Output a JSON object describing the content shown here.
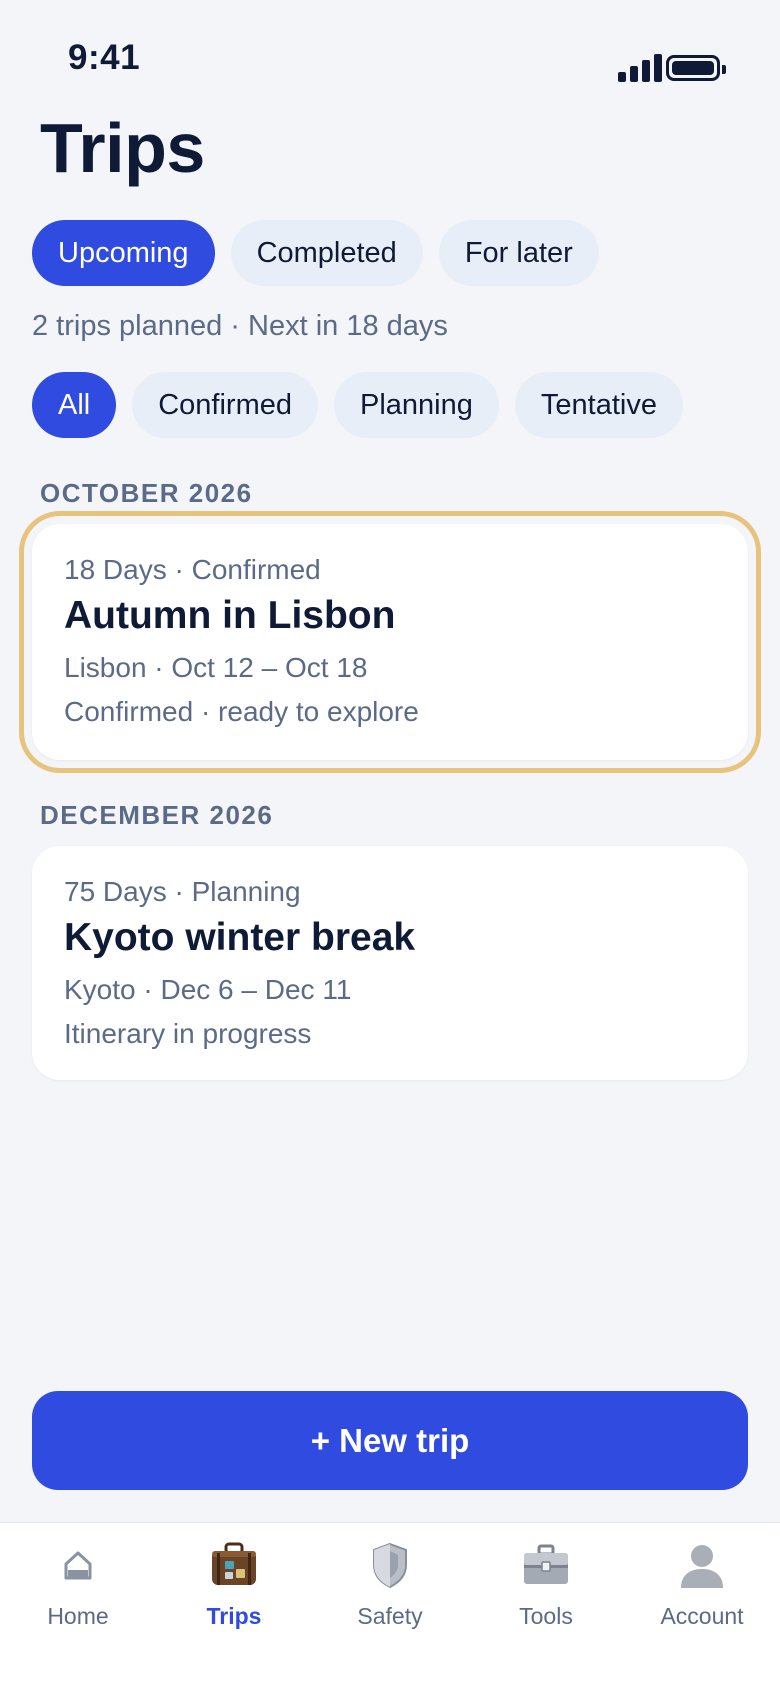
{
  "status_bar": {
    "time": "9:41"
  },
  "page_title": "Trips",
  "tabs": [
    {
      "label": "Upcoming",
      "active": true
    },
    {
      "label": "Completed",
      "active": false
    },
    {
      "label": "For later",
      "active": false
    }
  ],
  "summary": "2 trips planned · Next in 18 days",
  "filters": [
    {
      "label": "All",
      "active": true
    },
    {
      "label": "Confirmed",
      "active": false
    },
    {
      "label": "Planning",
      "active": false
    },
    {
      "label": "Tentative",
      "active": false
    }
  ],
  "sections": [
    {
      "label": "OCTOBER 2026",
      "trips": [
        {
          "meta": "18 Days · Confirmed",
          "title": "Autumn in Lisbon",
          "location": "Lisbon · Oct 12 – Oct 18",
          "note": "Confirmed · ready to explore",
          "highlighted": true
        }
      ]
    },
    {
      "label": "DECEMBER 2026",
      "trips": [
        {
          "meta": "75 Days · Planning",
          "title": "Kyoto winter break",
          "location": "Kyoto · Dec 6 – Dec 11",
          "note": "Itinerary in progress",
          "highlighted": false
        }
      ]
    }
  ],
  "new_trip_label": "+ New trip",
  "bottom_nav": [
    {
      "label": "Home",
      "icon": "home-icon",
      "active": false
    },
    {
      "label": "Trips",
      "icon": "suitcase-icon",
      "active": true
    },
    {
      "label": "Safety",
      "icon": "shield-icon",
      "active": false
    },
    {
      "label": "Tools",
      "icon": "toolbox-icon",
      "active": false
    },
    {
      "label": "Account",
      "icon": "person-icon",
      "active": false
    }
  ],
  "colors": {
    "accent": "#2f4be0",
    "text_primary": "#0f1b36",
    "text_secondary": "#5b6b87",
    "pill_inactive": "#e8eef8",
    "highlight_outline": "#e7c37e",
    "background": "#f3f5f9"
  }
}
